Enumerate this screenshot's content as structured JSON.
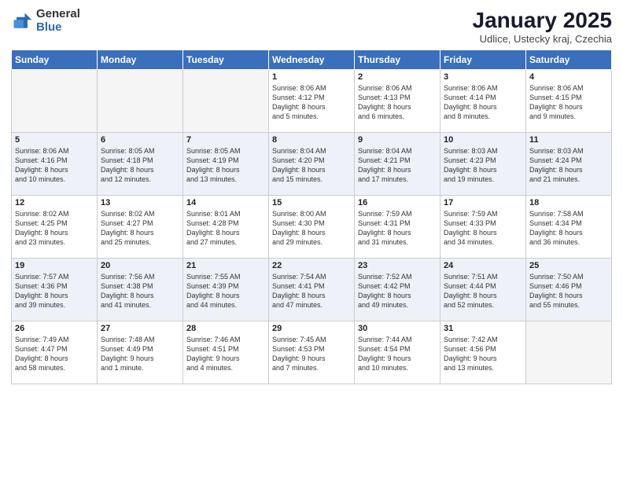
{
  "logo": {
    "general": "General",
    "blue": "Blue"
  },
  "title": "January 2025",
  "subtitle": "Udlice, Ustecky kraj, Czechia",
  "days_header": [
    "Sunday",
    "Monday",
    "Tuesday",
    "Wednesday",
    "Thursday",
    "Friday",
    "Saturday"
  ],
  "weeks": [
    {
      "shaded": false,
      "days": [
        {
          "num": "",
          "info": ""
        },
        {
          "num": "",
          "info": ""
        },
        {
          "num": "",
          "info": ""
        },
        {
          "num": "1",
          "info": "Sunrise: 8:06 AM\nSunset: 4:12 PM\nDaylight: 8 hours\nand 5 minutes."
        },
        {
          "num": "2",
          "info": "Sunrise: 8:06 AM\nSunset: 4:13 PM\nDaylight: 8 hours\nand 6 minutes."
        },
        {
          "num": "3",
          "info": "Sunrise: 8:06 AM\nSunset: 4:14 PM\nDaylight: 8 hours\nand 8 minutes."
        },
        {
          "num": "4",
          "info": "Sunrise: 8:06 AM\nSunset: 4:15 PM\nDaylight: 8 hours\nand 9 minutes."
        }
      ]
    },
    {
      "shaded": true,
      "days": [
        {
          "num": "5",
          "info": "Sunrise: 8:06 AM\nSunset: 4:16 PM\nDaylight: 8 hours\nand 10 minutes."
        },
        {
          "num": "6",
          "info": "Sunrise: 8:05 AM\nSunset: 4:18 PM\nDaylight: 8 hours\nand 12 minutes."
        },
        {
          "num": "7",
          "info": "Sunrise: 8:05 AM\nSunset: 4:19 PM\nDaylight: 8 hours\nand 13 minutes."
        },
        {
          "num": "8",
          "info": "Sunrise: 8:04 AM\nSunset: 4:20 PM\nDaylight: 8 hours\nand 15 minutes."
        },
        {
          "num": "9",
          "info": "Sunrise: 8:04 AM\nSunset: 4:21 PM\nDaylight: 8 hours\nand 17 minutes."
        },
        {
          "num": "10",
          "info": "Sunrise: 8:03 AM\nSunset: 4:23 PM\nDaylight: 8 hours\nand 19 minutes."
        },
        {
          "num": "11",
          "info": "Sunrise: 8:03 AM\nSunset: 4:24 PM\nDaylight: 8 hours\nand 21 minutes."
        }
      ]
    },
    {
      "shaded": false,
      "days": [
        {
          "num": "12",
          "info": "Sunrise: 8:02 AM\nSunset: 4:25 PM\nDaylight: 8 hours\nand 23 minutes."
        },
        {
          "num": "13",
          "info": "Sunrise: 8:02 AM\nSunset: 4:27 PM\nDaylight: 8 hours\nand 25 minutes."
        },
        {
          "num": "14",
          "info": "Sunrise: 8:01 AM\nSunset: 4:28 PM\nDaylight: 8 hours\nand 27 minutes."
        },
        {
          "num": "15",
          "info": "Sunrise: 8:00 AM\nSunset: 4:30 PM\nDaylight: 8 hours\nand 29 minutes."
        },
        {
          "num": "16",
          "info": "Sunrise: 7:59 AM\nSunset: 4:31 PM\nDaylight: 8 hours\nand 31 minutes."
        },
        {
          "num": "17",
          "info": "Sunrise: 7:59 AM\nSunset: 4:33 PM\nDaylight: 8 hours\nand 34 minutes."
        },
        {
          "num": "18",
          "info": "Sunrise: 7:58 AM\nSunset: 4:34 PM\nDaylight: 8 hours\nand 36 minutes."
        }
      ]
    },
    {
      "shaded": true,
      "days": [
        {
          "num": "19",
          "info": "Sunrise: 7:57 AM\nSunset: 4:36 PM\nDaylight: 8 hours\nand 39 minutes."
        },
        {
          "num": "20",
          "info": "Sunrise: 7:56 AM\nSunset: 4:38 PM\nDaylight: 8 hours\nand 41 minutes."
        },
        {
          "num": "21",
          "info": "Sunrise: 7:55 AM\nSunset: 4:39 PM\nDaylight: 8 hours\nand 44 minutes."
        },
        {
          "num": "22",
          "info": "Sunrise: 7:54 AM\nSunset: 4:41 PM\nDaylight: 8 hours\nand 47 minutes."
        },
        {
          "num": "23",
          "info": "Sunrise: 7:52 AM\nSunset: 4:42 PM\nDaylight: 8 hours\nand 49 minutes."
        },
        {
          "num": "24",
          "info": "Sunrise: 7:51 AM\nSunset: 4:44 PM\nDaylight: 8 hours\nand 52 minutes."
        },
        {
          "num": "25",
          "info": "Sunrise: 7:50 AM\nSunset: 4:46 PM\nDaylight: 8 hours\nand 55 minutes."
        }
      ]
    },
    {
      "shaded": false,
      "days": [
        {
          "num": "26",
          "info": "Sunrise: 7:49 AM\nSunset: 4:47 PM\nDaylight: 8 hours\nand 58 minutes."
        },
        {
          "num": "27",
          "info": "Sunrise: 7:48 AM\nSunset: 4:49 PM\nDaylight: 9 hours\nand 1 minute."
        },
        {
          "num": "28",
          "info": "Sunrise: 7:46 AM\nSunset: 4:51 PM\nDaylight: 9 hours\nand 4 minutes."
        },
        {
          "num": "29",
          "info": "Sunrise: 7:45 AM\nSunset: 4:53 PM\nDaylight: 9 hours\nand 7 minutes."
        },
        {
          "num": "30",
          "info": "Sunrise: 7:44 AM\nSunset: 4:54 PM\nDaylight: 9 hours\nand 10 minutes."
        },
        {
          "num": "31",
          "info": "Sunrise: 7:42 AM\nSunset: 4:56 PM\nDaylight: 9 hours\nand 13 minutes."
        },
        {
          "num": "",
          "info": ""
        }
      ]
    }
  ]
}
